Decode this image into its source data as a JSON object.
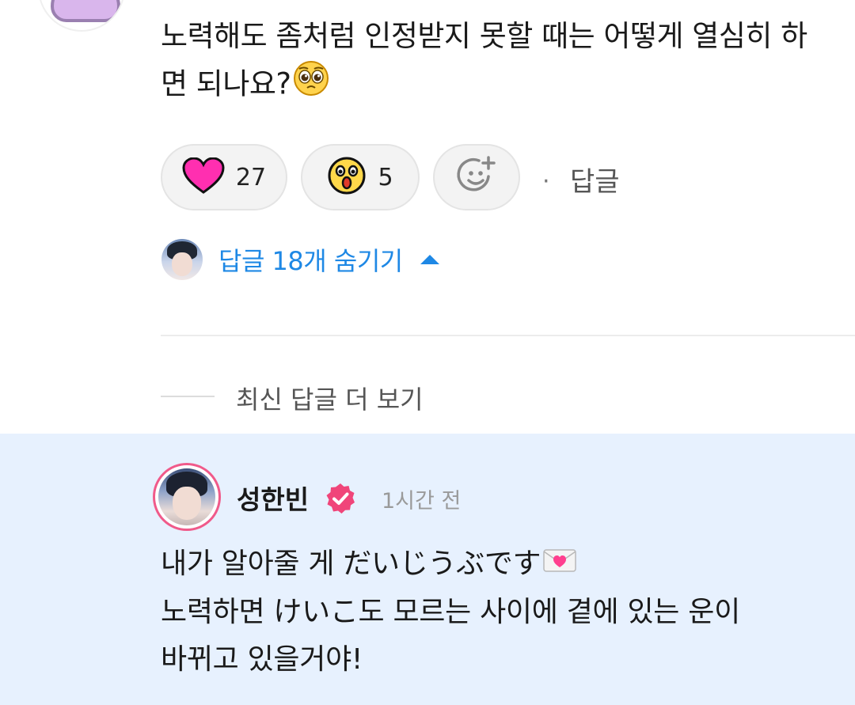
{
  "comment": {
    "text": "노력해도 좀처럼 인정받지 못할 때는 어떻게 열심히 하면 되나요?",
    "emoji": "pleading-face-emoji"
  },
  "reactions": [
    {
      "icon": "heart-icon",
      "count": "27"
    },
    {
      "icon": "surprised-face-icon",
      "count": "5"
    }
  ],
  "add_reaction_icon": "add-reaction-icon",
  "reply_link": "답글",
  "replies_toggle": {
    "label": "답글 18개 숨기기"
  },
  "more_latest": "최신 답글 더 보기",
  "reply": {
    "author": "성한빈",
    "time": "1시간 전",
    "lines": [
      "내가 알아줄 게 だいじうぶです",
      "노력하면 けいこ도 모르는 사이에 곁에 있는 운이",
      "바뀌고 있을거야!"
    ],
    "emoji": "love-letter-emoji"
  },
  "colors": {
    "accent_blue": "#1e88e5",
    "highlight_bg": "#e7f1fe",
    "verified_pink": "#f0457a",
    "heart_pink": "#ff2fb0"
  }
}
